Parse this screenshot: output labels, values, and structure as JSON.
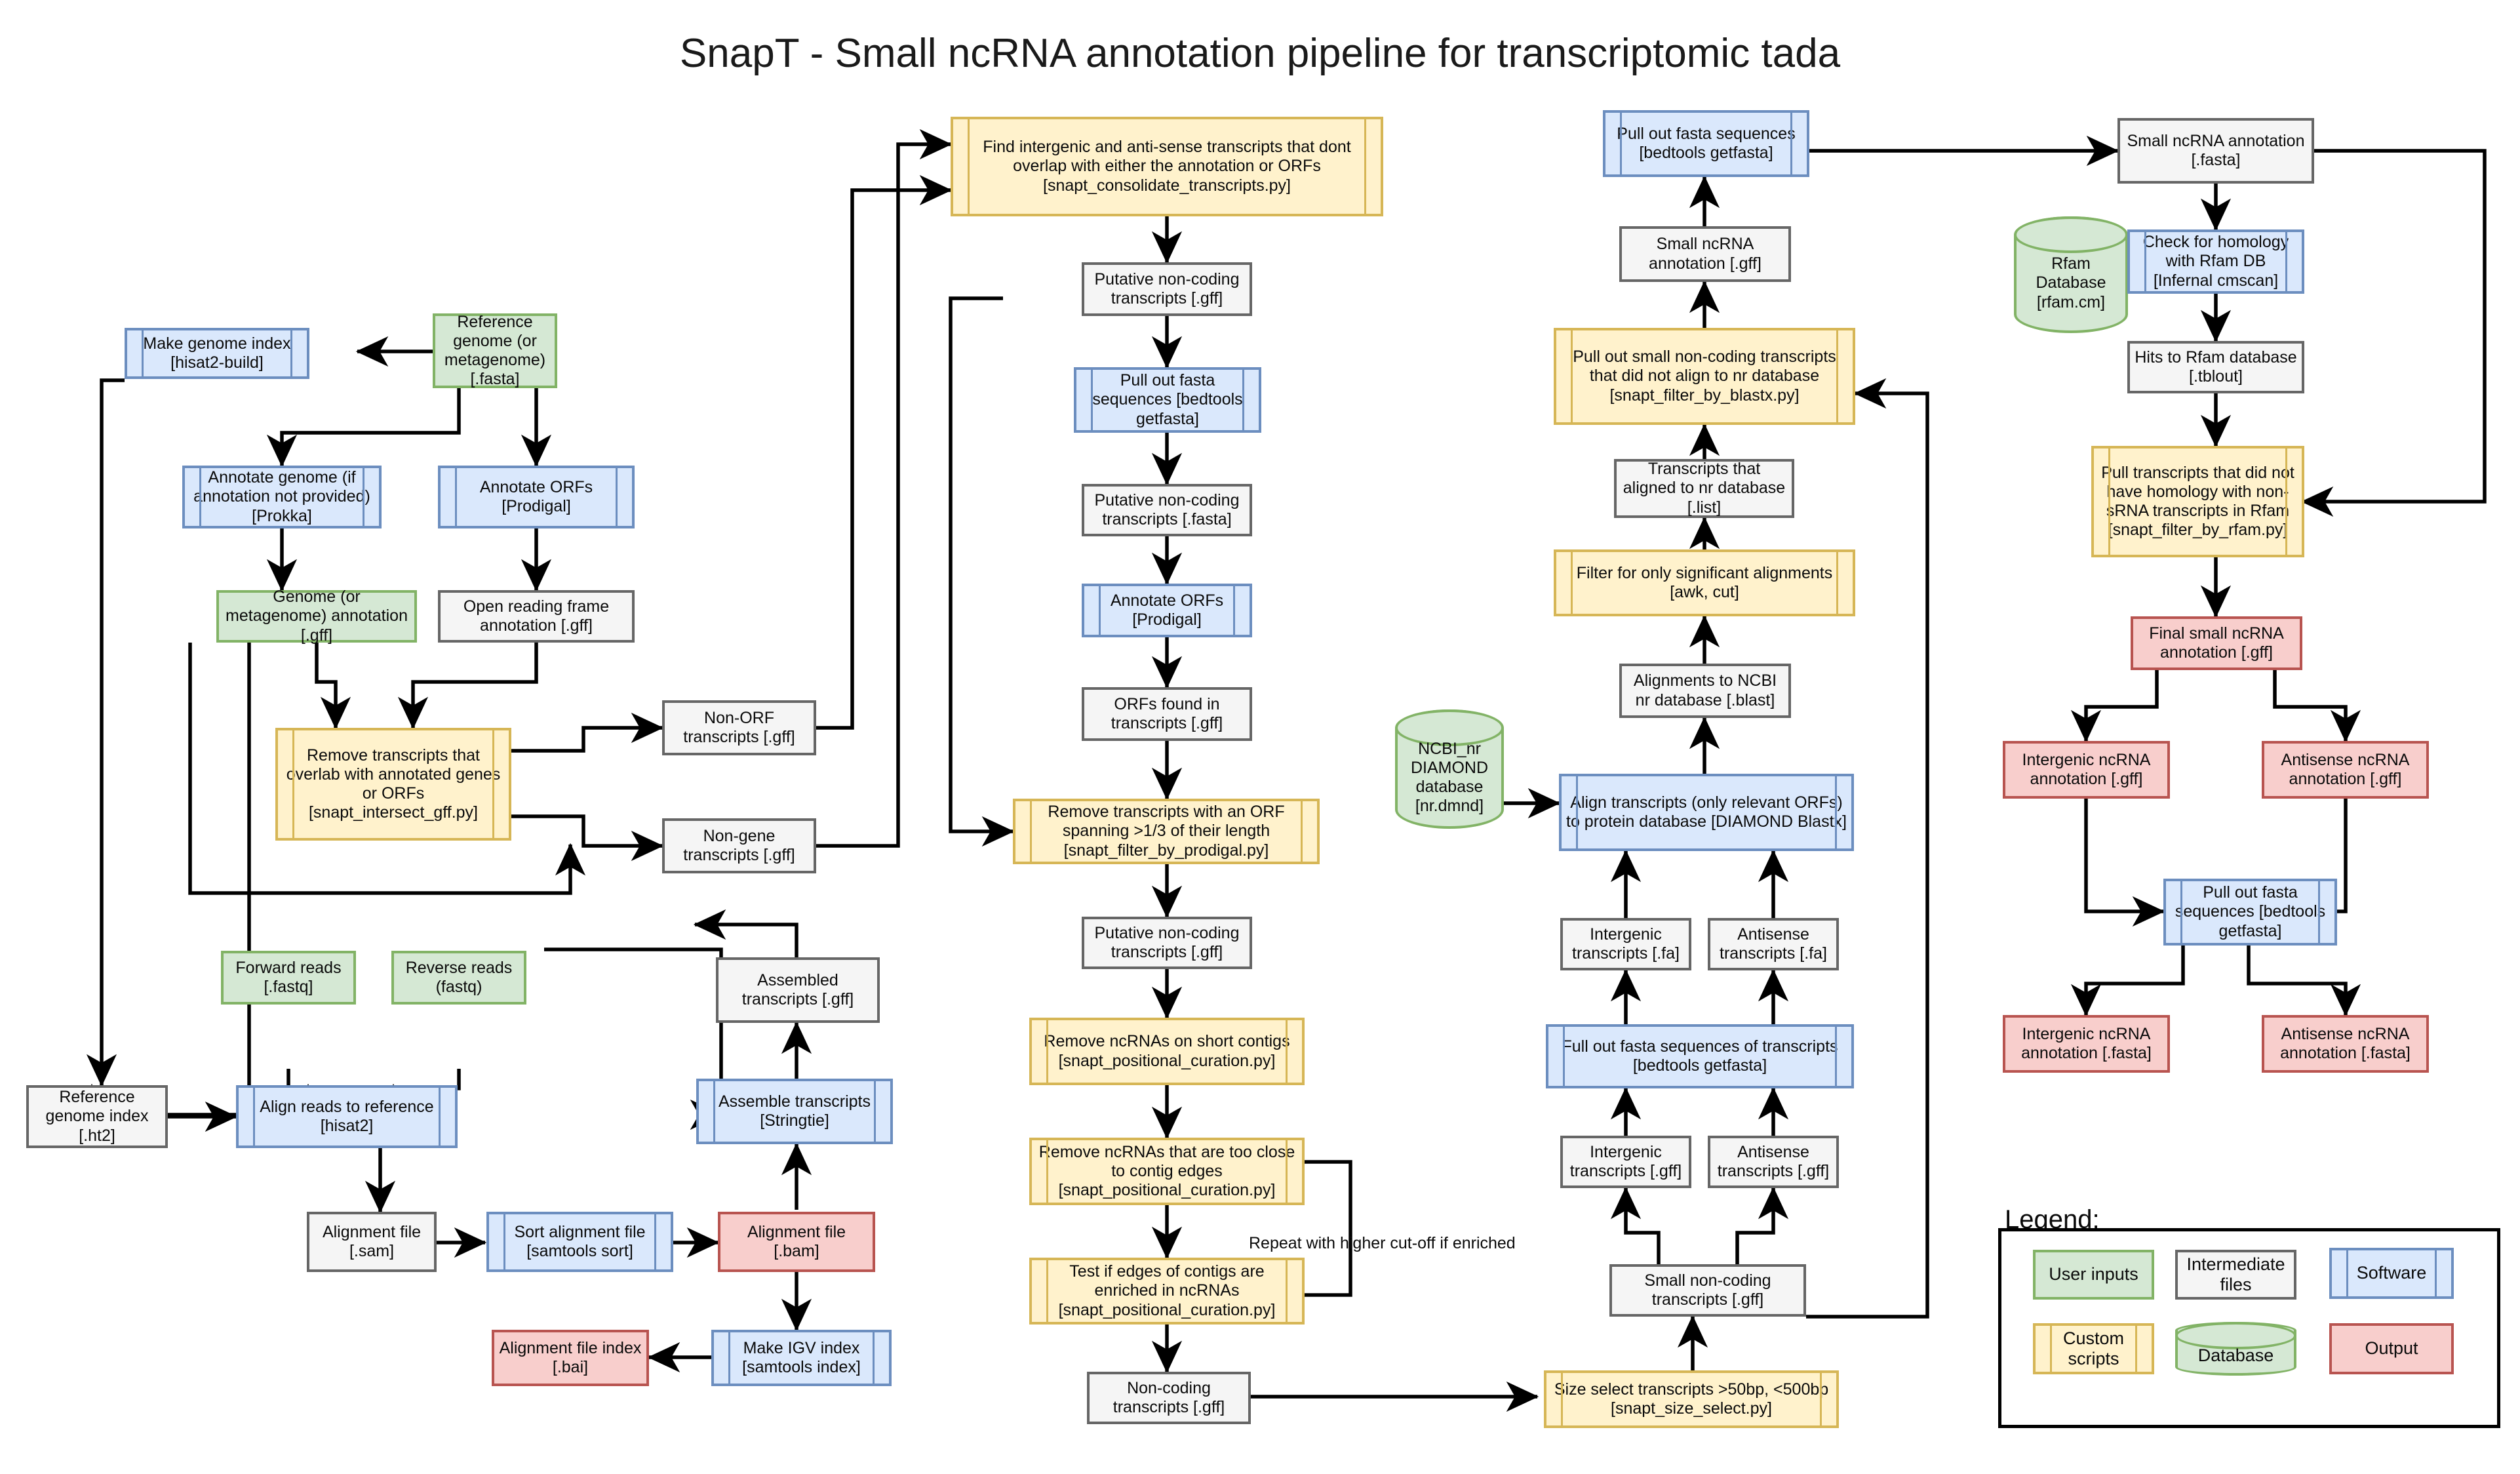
{
  "title": "SnapT - Small ncRNA annotation pipeline for transcriptomic tada",
  "legend": {
    "heading": "Legend:",
    "items": [
      {
        "key": "user_inputs",
        "label": "User inputs",
        "type": "input",
        "color": "#d5e8d4",
        "border": "#82b366"
      },
      {
        "key": "intermediate_files",
        "label": "Intermediate files",
        "type": "file",
        "color": "#f5f5f5",
        "border": "#666666"
      },
      {
        "key": "software",
        "label": "Software",
        "type": "software",
        "color": "#dae8fc",
        "border": "#6c8ebf"
      },
      {
        "key": "custom_scripts",
        "label": "Custom scripts",
        "type": "script",
        "color": "#fff2cc",
        "border": "#d6b656"
      },
      {
        "key": "database",
        "label": "Database",
        "type": "database",
        "color": "#d5e8d4",
        "border": "#82b366"
      },
      {
        "key": "output",
        "label": "Output",
        "type": "output",
        "color": "#f8cecc",
        "border": "#b85450"
      }
    ]
  },
  "edge_labels": [
    {
      "key": "repeat_cutoff",
      "text": "Repeat with higher cut-off if enriched"
    }
  ],
  "nodes": {
    "make_genome_index": "Make genome index [hisat2-build]",
    "reference_genome": "Reference genome (or metagenome) [.fasta]",
    "annotate_genome": "Annotate genome (if annotation not provided) [Prokka]",
    "annotate_orfs_left": "Annotate ORFs [Prodigal]",
    "genome_annotation": "Genome (or metagenome) annotation [.gff]",
    "orf_annotation": "Open reading frame annotation [.gff]",
    "remove_overlap": "Remove transcripts that overlab with annotated genes or ORFs [snapt_intersect_gff.py]",
    "non_orf_transcripts": "Non-ORF transcripts [.gff]",
    "non_gene_transcripts": "Non-gene transcripts [.gff]",
    "forward_reads": "Forward reads [.fastq]",
    "reverse_reads": "Reverse reads (fastq)",
    "assembled_transcripts": "Assembled transcripts [.gff]",
    "reference_genome_index": "Reference genome index [.ht2]",
    "align_reads": "Align reads to reference [hisat2]",
    "assemble_transcripts": "Assemble transcripts [Stringtie]",
    "alignment_sam": "Alignment file [.sam]",
    "sort_alignment": "Sort alignment file [samtools sort]",
    "alignment_bam": "Alignment file [.bam]",
    "alignment_bai": "Alignment file index [.bai]",
    "make_igv_index": "Make IGV index [samtools index]",
    "find_intergenic": "Find intergenic and anti-sense transcripts that dont overlap with either the annotation or ORFs [snapt_consolidate_transcripts.py]",
    "putative_gff_1": "Putative non-coding transcripts [.gff]",
    "pull_fasta_mid": "Pull out fasta sequences [bedtools getfasta]",
    "putative_fasta": "Putative non-coding transcripts [.fasta]",
    "annotate_orfs_mid": "Annotate ORFs [Prodigal]",
    "orfs_found": "ORFs found in transcripts [.gff]",
    "remove_orf_span": "Remove transcripts with an ORF spanning >1/3 of their length [snapt_filter_by_prodigal.py]",
    "putative_gff_2": "Putative non-coding transcripts [.gff]",
    "remove_short_contigs": "Remove ncRNAs on short contigs [snapt_positional_curation.py]",
    "remove_close_edges": "Remove ncRNAs that are too close to contig edges [snapt_positional_curation.py]",
    "test_edges": "Test if edges of contigs are enriched in ncRNAs [snapt_positional_curation.py]",
    "noncoding_gff": "Non-coding transcripts [.gff]",
    "size_select": "Size select transcripts >50bp, <500bp [snapt_size_select.py]",
    "small_noncoding_gff": "Small non-coding transcripts [.gff]",
    "intergenic_gff_mid": "Intergenic transcripts [.gff]",
    "antisense_gff_mid": "Antisense transcripts [.gff]",
    "full_out_fasta": "Full out fasta sequences of transcripts [bedtools getfasta]",
    "intergenic_fa": "Intergenic transcripts [.fa]",
    "antisense_fa": "Antisense transcripts [.fa]",
    "ncbi_nr_db": "NCBI_nr DIAMOND database [nr.dmnd]",
    "align_transcripts": "Align transcripts (only relevant ORFs) to protein database [DIAMOND Blastx]",
    "alignments_blast": "Alignments to NCBI nr database [.blast]",
    "filter_significant": "Filter for only significant alignments [awk, cut]",
    "transcripts_aligned_list": "Transcripts that aligned to nr database [.list]",
    "pull_small_noncoding": "Pull out small non-coding transcripts that did not align to nr database [snapt_filter_by_blastx.py]",
    "small_ncrna_gff": "Small ncRNA annotation [.gff]",
    "pull_fasta_col3": "Pull out fasta sequences [bedtools getfasta]",
    "rfam_db": "Rfam Database [rfam.cm]",
    "small_ncrna_fasta": "Small ncRNA annotation [.fasta]",
    "check_homology": "Check for homology with Rfam DB [Infernal cmscan]",
    "hits_rfam": "Hits to Rfam database [.tblout]",
    "pull_no_homology": "Pull transcripts that did not have homology with non-sRNA transcripts in Rfam [snapt_filter_by_rfam.py]",
    "final_small_ncrna": "Final small ncRNA annotation [.gff]",
    "intergenic_ncrna_gff": "Intergenic ncRNA annotation [.gff]",
    "antisense_ncrna_gff": "Antisense ncRNA annotation [.gff]",
    "pull_fasta_right": "Pull out fasta sequences [bedtools getfasta]",
    "intergenic_ncrna_fasta": "Intergenic ncRNA annotation [.fasta]",
    "antisense_ncrna_fasta": "Antisense ncRNA annotation [.fasta]"
  }
}
